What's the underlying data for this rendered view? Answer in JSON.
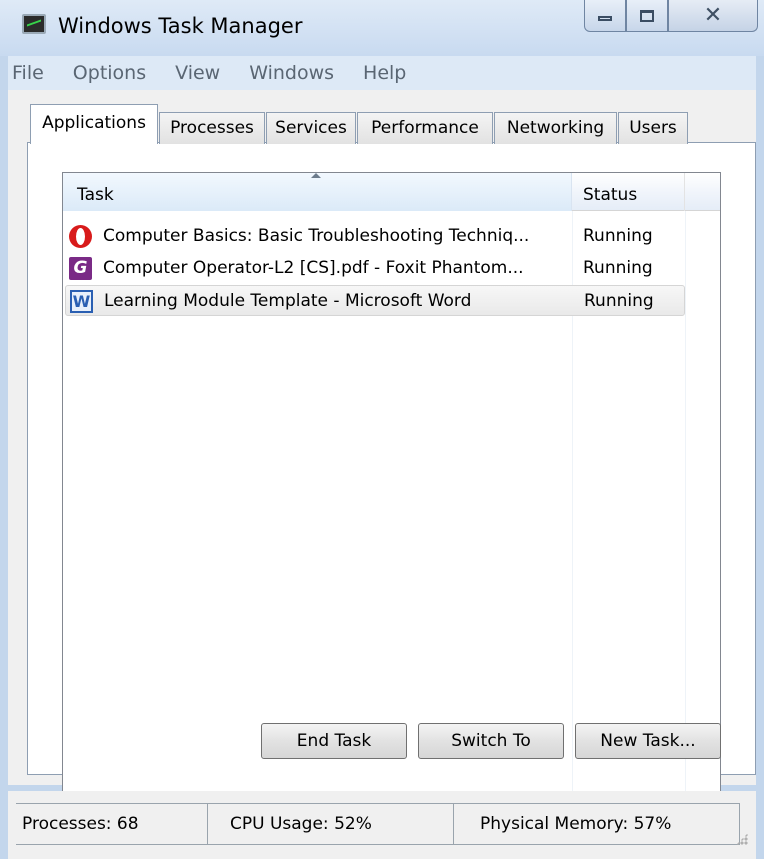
{
  "window": {
    "title": "Windows Task Manager",
    "icon": "task-manager-icon"
  },
  "menubar": {
    "items": [
      "File",
      "Options",
      "View",
      "Windows",
      "Help"
    ]
  },
  "tabs": [
    {
      "label": "Applications",
      "active": true
    },
    {
      "label": "Processes",
      "active": false
    },
    {
      "label": "Services",
      "active": false
    },
    {
      "label": "Performance",
      "active": false
    },
    {
      "label": "Networking",
      "active": false
    },
    {
      "label": "Users",
      "active": false
    }
  ],
  "list": {
    "columns": [
      "Task",
      "Status"
    ],
    "sort": "ascending",
    "rows": [
      {
        "task": "Computer Basics: Basic Troubleshooting Techniq...",
        "status": "Running",
        "icon": "opera-icon",
        "selected": false
      },
      {
        "task": "Computer Operator-L2 [CS].pdf - Foxit Phantom...",
        "status": "Running",
        "icon": "foxit-phantom-icon",
        "selected": false
      },
      {
        "task": "Learning Module Template - Microsoft Word",
        "status": "Running",
        "icon": "microsoft-word-icon",
        "selected": true
      }
    ]
  },
  "buttons": {
    "end_task": "End Task",
    "switch_to": "Switch To",
    "new_task": "New Task..."
  },
  "statusbar": {
    "processes": "Processes: 68",
    "cpu": "CPU Usage: 52%",
    "memory": "Physical Memory: 57%"
  }
}
